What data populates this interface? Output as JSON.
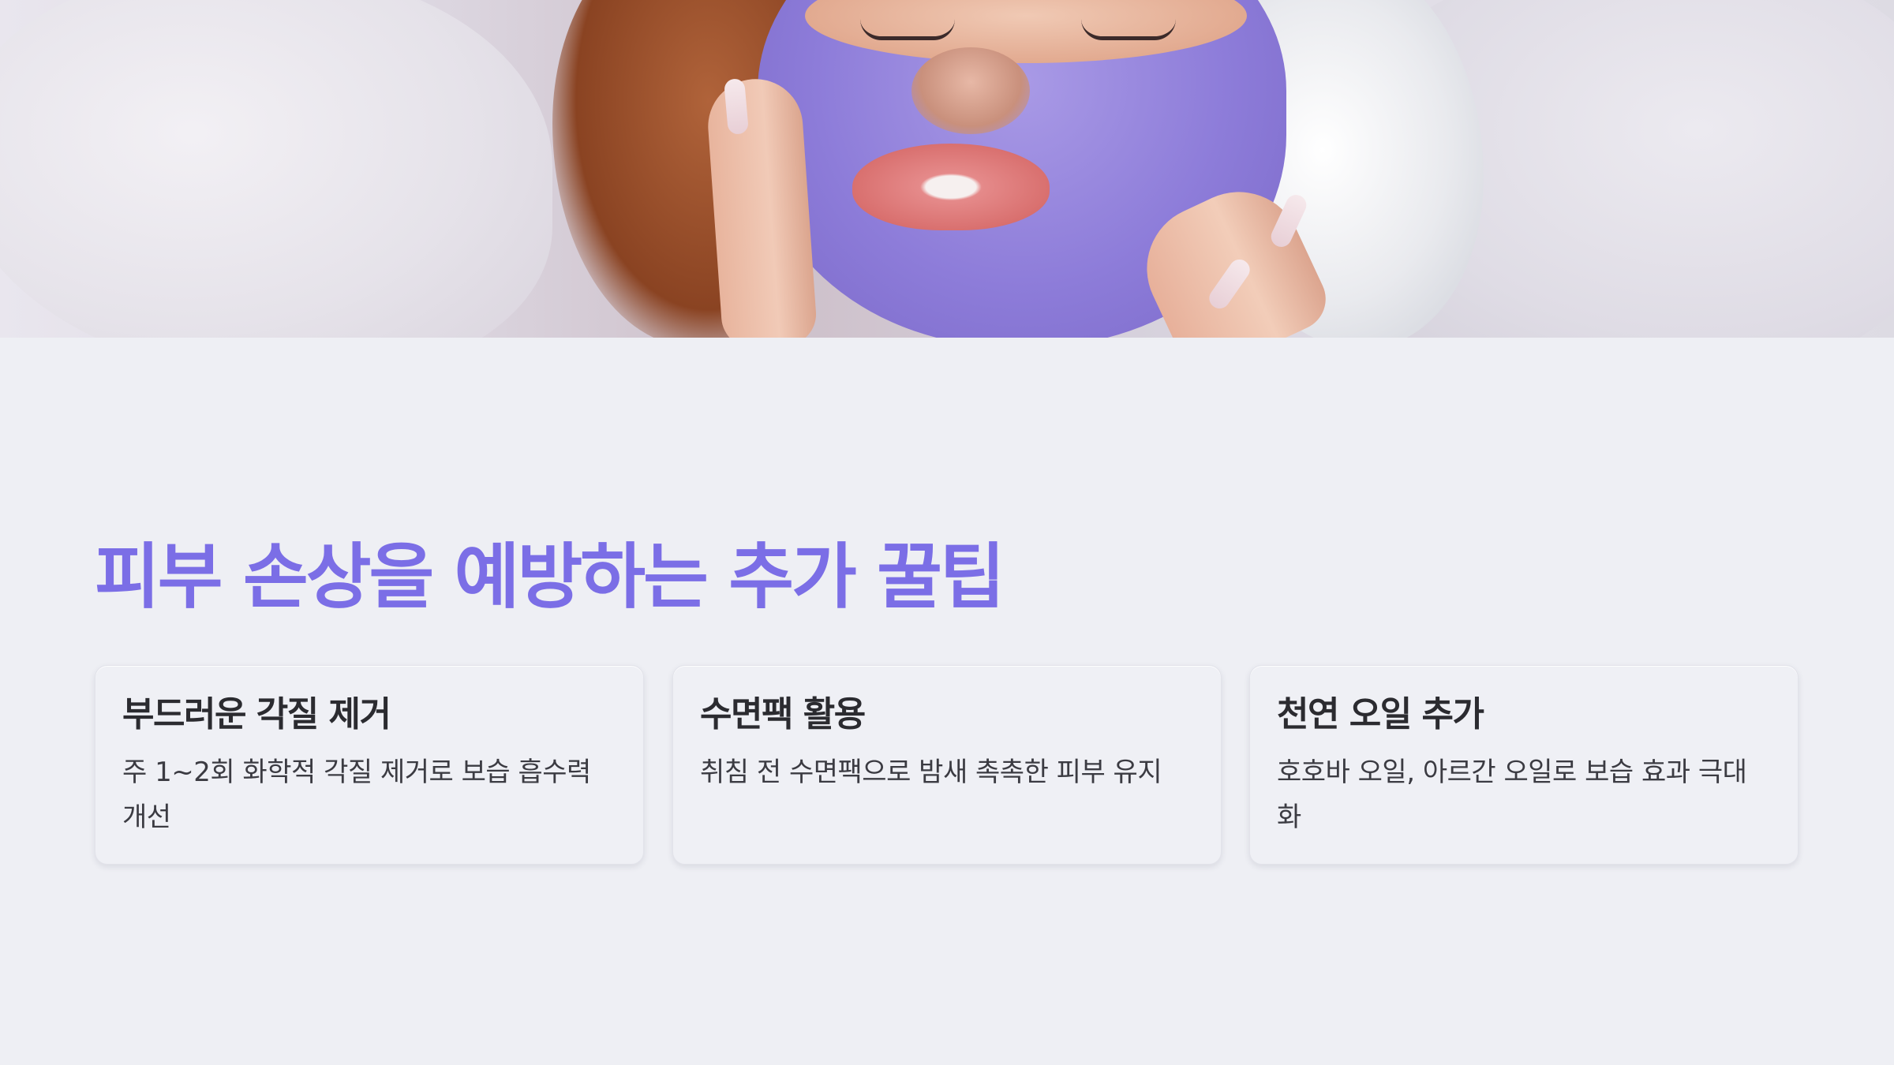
{
  "hero": {
    "image_description_icon": "woman-purple-face-mask-photo"
  },
  "title": "피부 손상을 예방하는 추가 꿀팁",
  "colors": {
    "title": "#7b6ee6",
    "background": "#eeeff4",
    "card": "#eff0f5",
    "text": "#2b2b30"
  },
  "cards": [
    {
      "title": "부드러운 각질 제거",
      "desc": "주 1~2회 화학적 각질 제거로 보습 흡수력 개선"
    },
    {
      "title": "수면팩 활용",
      "desc": "취침 전 수면팩으로 밤새 촉촉한 피부 유지"
    },
    {
      "title": "천연 오일 추가",
      "desc": "호호바 오일, 아르간 오일로 보습 효과 극대화"
    }
  ]
}
